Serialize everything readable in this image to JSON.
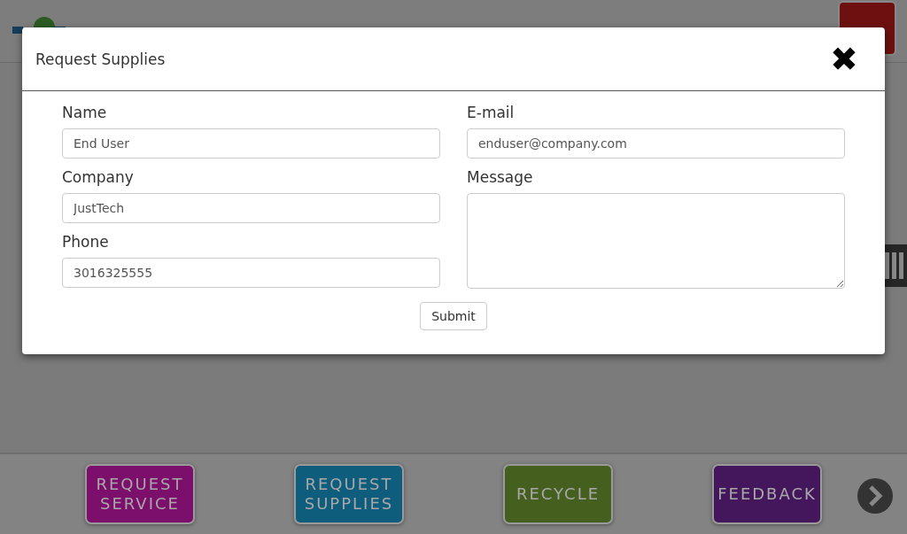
{
  "dialog": {
    "title": "Request Supplies",
    "close": "✖",
    "left_fields": [
      {
        "label": "Name",
        "kind": "input",
        "value": "End User"
      },
      {
        "label": "Company",
        "kind": "input",
        "value": "JustTech"
      },
      {
        "label": "Phone",
        "kind": "input",
        "value": "3016325555"
      }
    ],
    "right_fields": [
      {
        "label": "E-mail",
        "kind": "input",
        "value": "enduser@company.com"
      },
      {
        "label": "Message",
        "kind": "textarea"
      }
    ],
    "submit": "Submit"
  },
  "footer_buttons": [
    {
      "lines": [
        "REQUEST",
        "SERVICE"
      ],
      "color": "#7c0f6c"
    },
    {
      "lines": [
        "REQUEST",
        "SUPPLIES"
      ],
      "color": "#0e5d7d"
    },
    {
      "lines": [
        "RECYCLE"
      ],
      "color": "#455f1f"
    },
    {
      "lines": [
        "FEEDBACK"
      ],
      "color": "#44175d"
    }
  ]
}
